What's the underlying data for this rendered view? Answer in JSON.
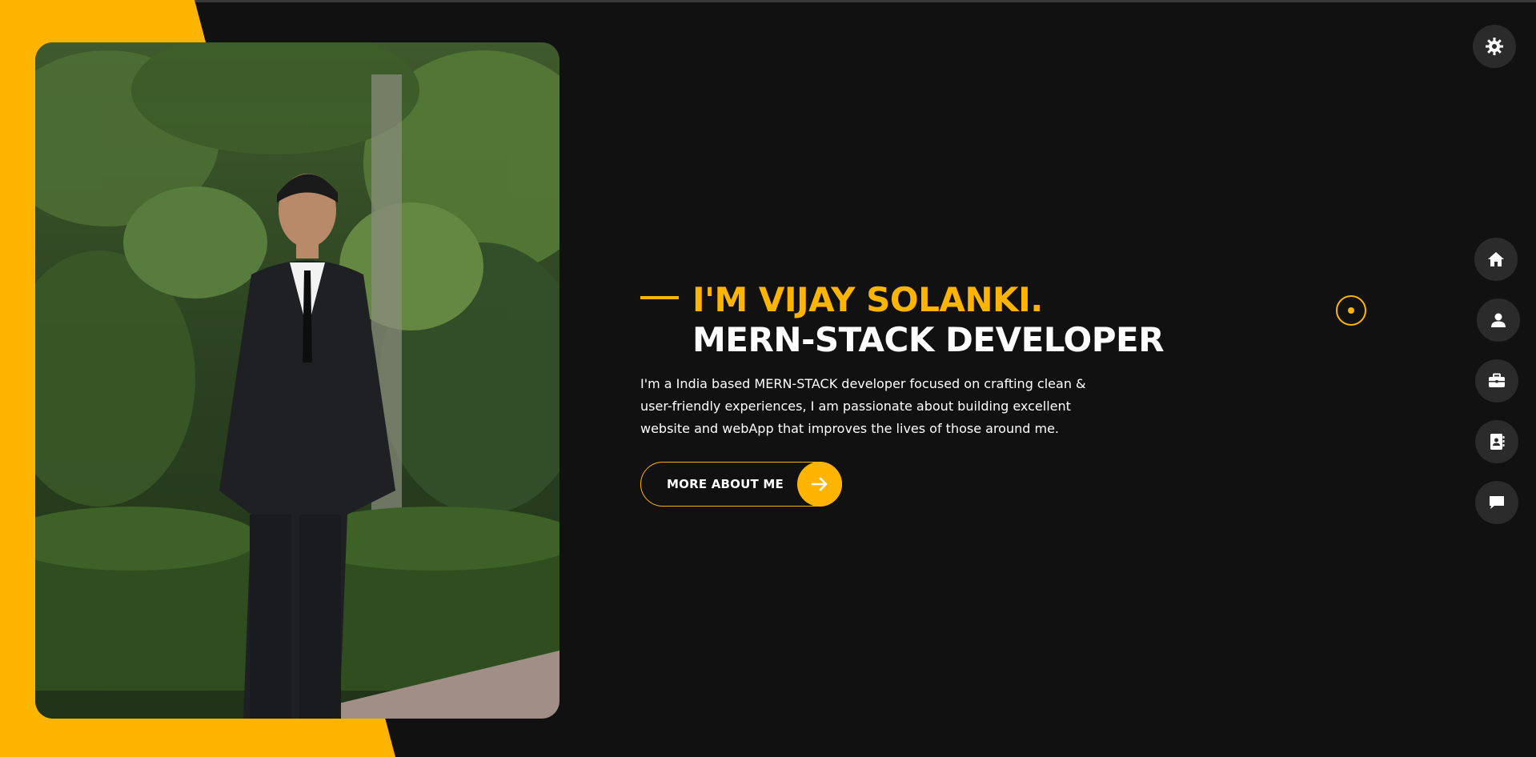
{
  "hero": {
    "name_line": "I'M VIJAY SOLANKI.",
    "role_line": "MERN-STACK DEVELOPER",
    "description": "I'm a India based MERN-STACK developer focused on crafting clean & user-friendly experiences, I am passionate about building excellent website and webApp that improves the lives of those around me.",
    "cta_label": "MORE ABOUT ME"
  },
  "theme": {
    "accent": "#ffb400",
    "background": "#111111",
    "button_bg": "#2b2b2b"
  },
  "icons": {
    "theme_toggle": "gear-icon",
    "cta": "arrow-right-icon",
    "nav": [
      "home-icon",
      "user-icon",
      "briefcase-icon",
      "contact-card-icon",
      "chat-icon"
    ]
  }
}
